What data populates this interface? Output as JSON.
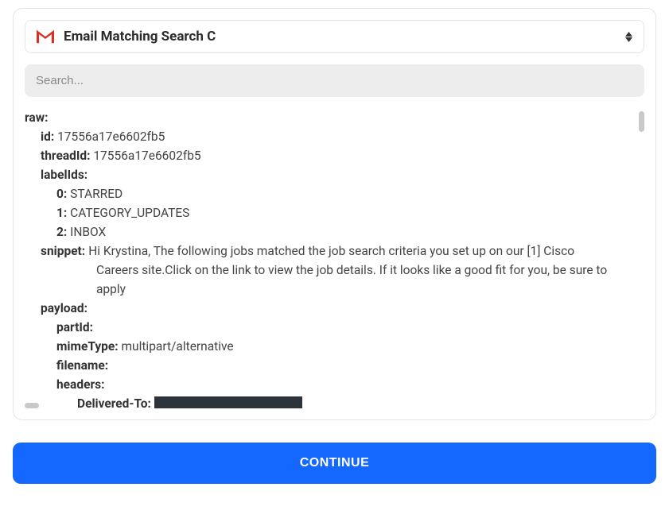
{
  "header": {
    "select_label": "Email Matching Search C"
  },
  "search": {
    "placeholder": "Search..."
  },
  "raw": {
    "label": "raw:",
    "id_label": "id:",
    "id_value": "17556a17e6602fb5",
    "threadId_label": "threadId:",
    "threadId_value": "17556a17e6602fb5",
    "labelIds_label": "labelIds:",
    "labelIds": {
      "i0_label": "0:",
      "i0_value": "STARRED",
      "i1_label": "1:",
      "i1_value": "CATEGORY_UPDATES",
      "i2_label": "2:",
      "i2_value": "INBOX"
    },
    "snippet_label": "snippet:",
    "snippet_line1": "Hi Krystina, The following jobs matched the job search criteria you set up on our [1] Cisco",
    "snippet_line2": "Careers site.Click on the link to view the job details. If it looks like a good fit for you, be sure to",
    "snippet_line3": "apply",
    "payload_label": "payload:",
    "payload": {
      "partId_label": "partId:",
      "mimeType_label": "mimeType:",
      "mimeType_value": "multipart/alternative",
      "filename_label": "filename:",
      "headers_label": "headers:",
      "deliveredTo_label": "Delivered-To:"
    }
  },
  "actions": {
    "continue_label": "CONTINUE"
  }
}
